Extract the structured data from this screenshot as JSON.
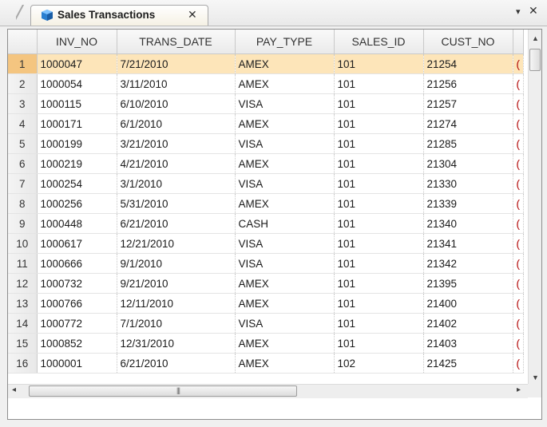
{
  "tab": {
    "icon": "table-cube-icon",
    "title": "Sales Transactions",
    "close_glyph": "✕"
  },
  "window": {
    "menu_glyph": "▾",
    "close_glyph": "✕"
  },
  "grid": {
    "columns": [
      "INV_NO",
      "TRANS_DATE",
      "PAY_TYPE",
      "SALES_ID",
      "CUST_NO"
    ],
    "selected_row": 1,
    "rows": [
      {
        "n": "1",
        "cells": [
          "1000047",
          "7/21/2010",
          "AMEX",
          "101",
          "21254"
        ]
      },
      {
        "n": "2",
        "cells": [
          "1000054",
          "3/11/2010",
          "AMEX",
          "101",
          "21256"
        ]
      },
      {
        "n": "3",
        "cells": [
          "1000115",
          "6/10/2010",
          "VISA",
          "101",
          "21257"
        ]
      },
      {
        "n": "4",
        "cells": [
          "1000171",
          "6/1/2010",
          "AMEX",
          "101",
          "21274"
        ]
      },
      {
        "n": "5",
        "cells": [
          "1000199",
          "3/21/2010",
          "VISA",
          "101",
          "21285"
        ]
      },
      {
        "n": "6",
        "cells": [
          "1000219",
          "4/21/2010",
          "AMEX",
          "101",
          "21304"
        ]
      },
      {
        "n": "7",
        "cells": [
          "1000254",
          "3/1/2010",
          "VISA",
          "101",
          "21330"
        ]
      },
      {
        "n": "8",
        "cells": [
          "1000256",
          "5/31/2010",
          "AMEX",
          "101",
          "21339"
        ]
      },
      {
        "n": "9",
        "cells": [
          "1000448",
          "6/21/2010",
          "CASH",
          "101",
          "21340"
        ]
      },
      {
        "n": "10",
        "cells": [
          "1000617",
          "12/21/2010",
          "VISA",
          "101",
          "21341"
        ]
      },
      {
        "n": "11",
        "cells": [
          "1000666",
          "9/1/2010",
          "VISA",
          "101",
          "21342"
        ]
      },
      {
        "n": "12",
        "cells": [
          "1000732",
          "9/21/2010",
          "AMEX",
          "101",
          "21395"
        ]
      },
      {
        "n": "13",
        "cells": [
          "1000766",
          "12/11/2010",
          "AMEX",
          "101",
          "21400"
        ]
      },
      {
        "n": "14",
        "cells": [
          "1000772",
          "7/1/2010",
          "VISA",
          "101",
          "21402"
        ]
      },
      {
        "n": "15",
        "cells": [
          "1000852",
          "12/31/2010",
          "AMEX",
          "101",
          "21403"
        ]
      },
      {
        "n": "16",
        "cells": [
          "1000001",
          "6/21/2010",
          "AMEX",
          "102",
          "21425"
        ]
      }
    ],
    "partial_column_glyph": "("
  },
  "scrollbars": {
    "up": "▲",
    "down": "▼",
    "left": "◂",
    "right": "▸",
    "grip": "|||"
  },
  "colors": {
    "selected_row": "#fde5b9",
    "selected_row_header": "#f4c580",
    "partial_column_text": "#b00000",
    "tab_icon": "#2a7fd0"
  }
}
